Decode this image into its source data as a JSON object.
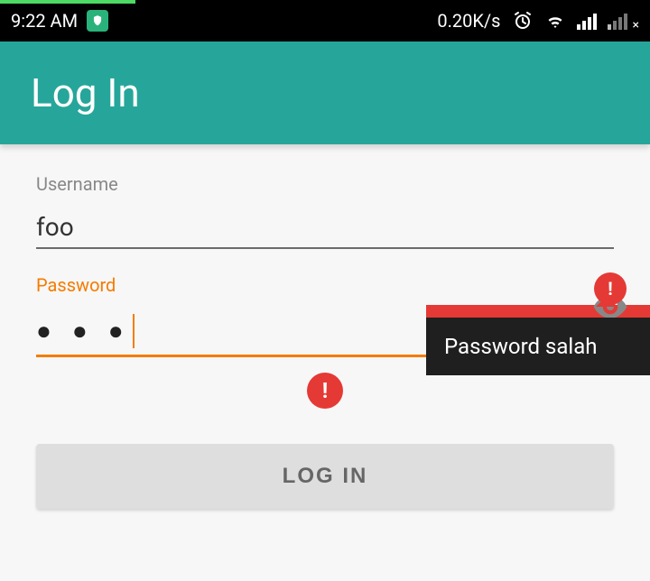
{
  "status_bar": {
    "time": "9:22 AM",
    "data_speed": "0.20K/s"
  },
  "app_bar": {
    "title": "Log In"
  },
  "form": {
    "username_label": "Username",
    "username_value": "foo",
    "password_label": "Password",
    "password_masked": "● ● ●",
    "error_tooltip": "Password salah"
  },
  "buttons": {
    "login": "LOG IN"
  }
}
